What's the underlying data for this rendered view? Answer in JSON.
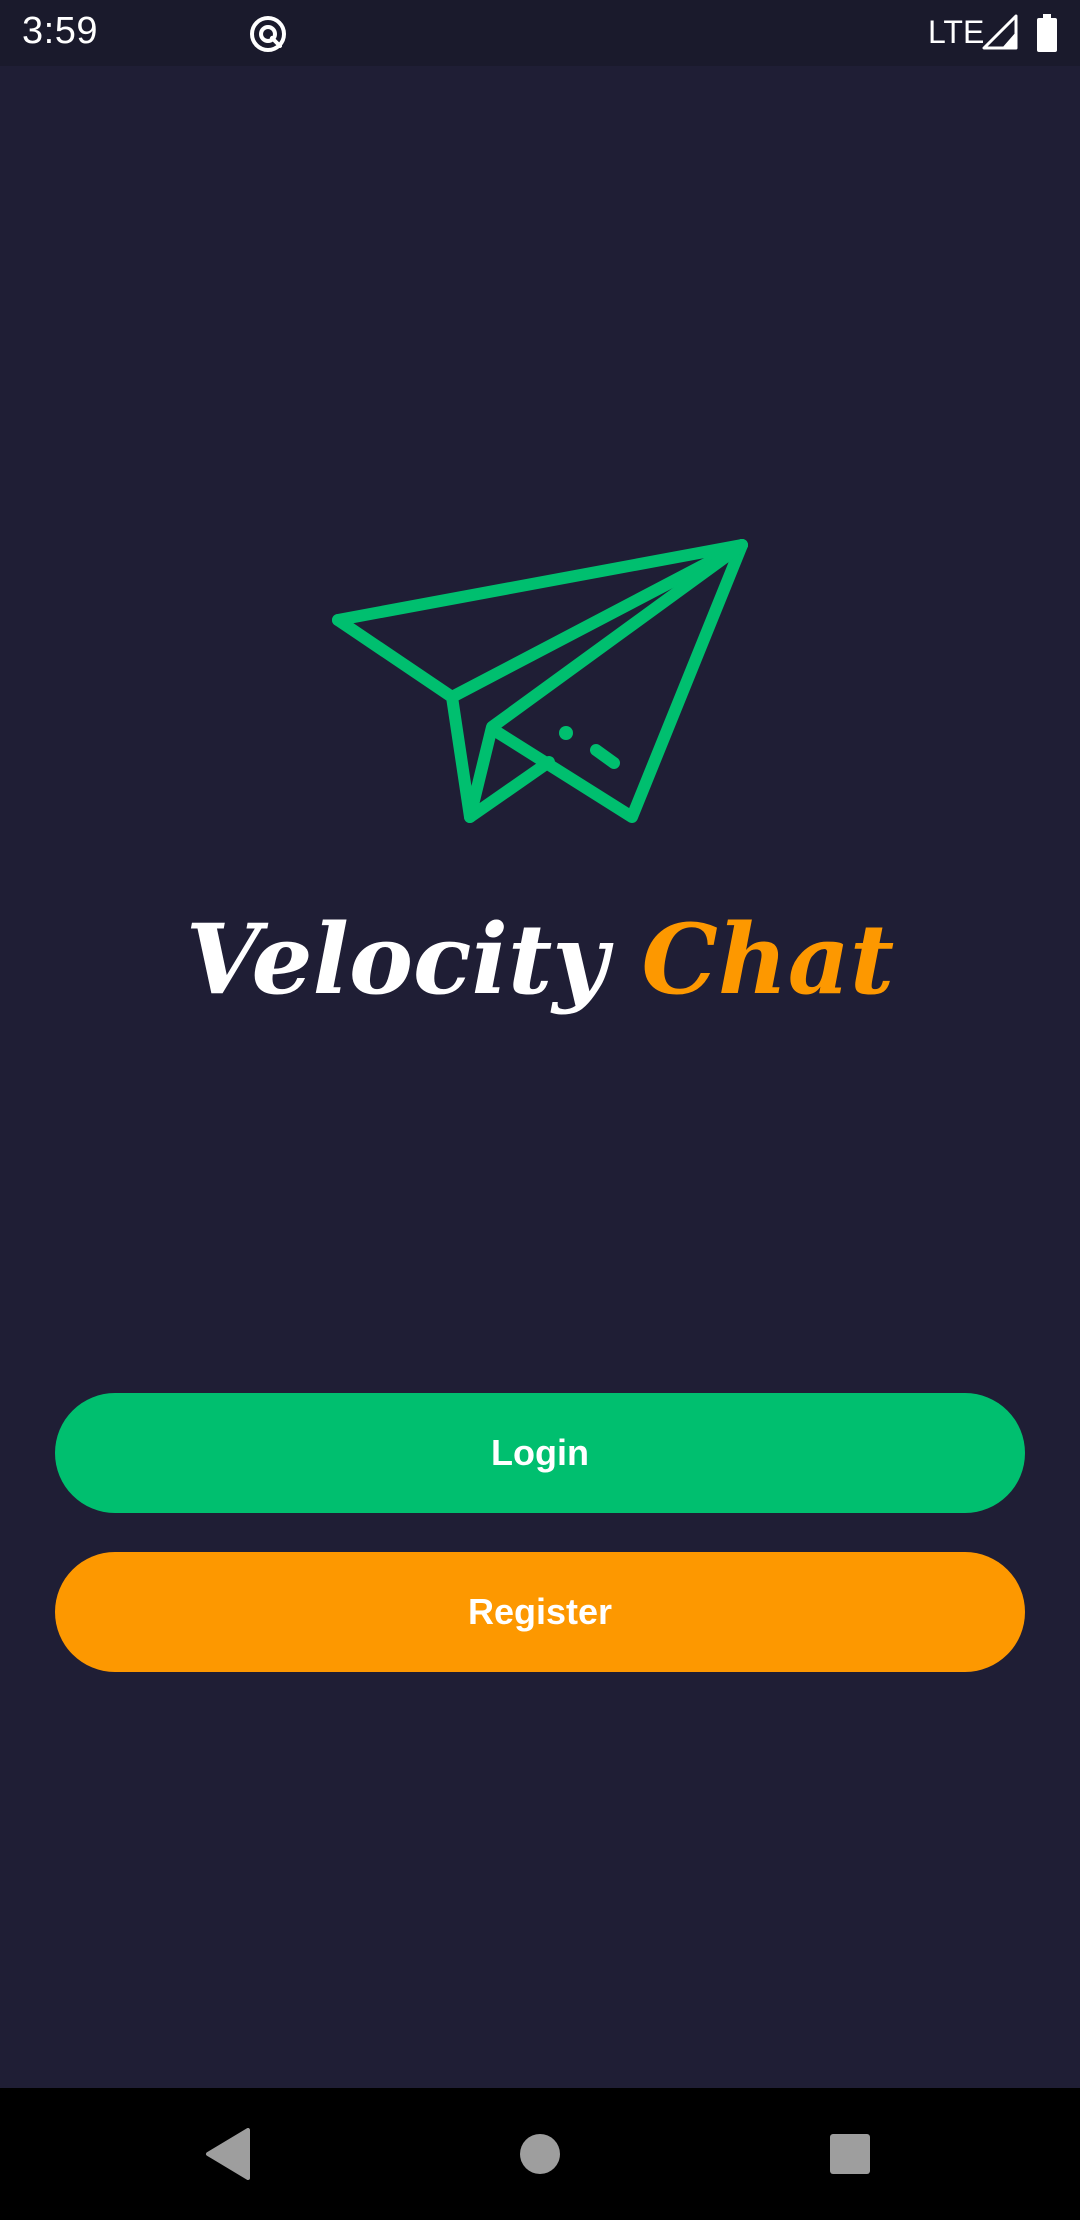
{
  "status_bar": {
    "time": "3:59",
    "network": "LTE",
    "icons": [
      "app-notification-icon",
      "signal-icon",
      "battery-icon"
    ]
  },
  "logo": {
    "icon": "paper-plane-icon",
    "title_part1": "Velocity",
    "title_part2": "Chat"
  },
  "actions": {
    "login_label": "Login",
    "register_label": "Register"
  },
  "nav_bar": {
    "icons": [
      "back-icon",
      "home-icon",
      "recents-icon"
    ]
  },
  "colors": {
    "background": "#1f1e35",
    "status_bar": "#1a1a2c",
    "primary_green": "#00bf6f",
    "accent_orange": "#fd9800",
    "text_white": "#ffffff",
    "nav_bar": "#000000",
    "nav_icon": "#9e9e9e"
  }
}
